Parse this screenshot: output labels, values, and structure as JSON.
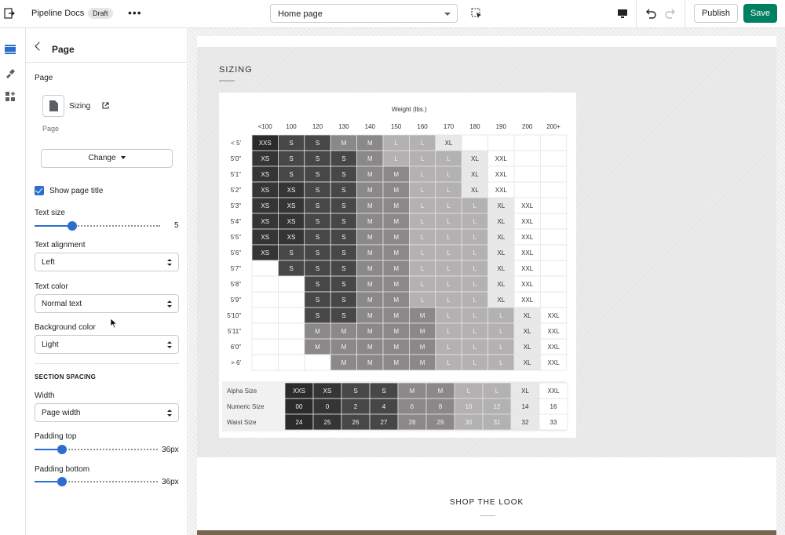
{
  "topbar": {
    "app_name": "Pipeline Docs",
    "status_badge": "Draft",
    "page_select_value": "Home page",
    "publish_label": "Publish",
    "save_label": "Save",
    "icons": [
      "exit-icon",
      "more-icon",
      "inspect-icon",
      "desktop-icon",
      "undo-icon",
      "redo-icon"
    ]
  },
  "rail": {
    "icons": [
      "sections-icon",
      "theme-settings-icon",
      "apps-icon"
    ],
    "accent": "#2c6ecb"
  },
  "panel": {
    "title": "Page",
    "page_label": "Page",
    "page_name": "Sizing",
    "page_type": "Page",
    "change_label": "Change",
    "show_title_label": "Show page title",
    "show_title_checked": true,
    "text_size_label": "Text size",
    "text_size_value": "5",
    "text_size_fraction": 0.3,
    "text_alignment_label": "Text alignment",
    "text_alignment_value": "Left",
    "text_color_label": "Text color",
    "text_color_value": "Normal text",
    "background_color_label": "Background color",
    "background_color_value": "Light",
    "section_spacing_label": "SECTION SPACING",
    "width_label": "Width",
    "width_value": "Page width",
    "padding_top_label": "Padding top",
    "padding_top_value": "36px",
    "padding_top_fraction": 0.22,
    "padding_bottom_label": "Padding bottom",
    "padding_bottom_value": "36px",
    "padding_bottom_fraction": 0.22
  },
  "preview": {
    "sizing_title": "SIZING",
    "shop_title": "SHOP THE LOOK"
  },
  "chart_data": {
    "type": "table",
    "title": "Weight (lbs.)",
    "columns": [
      "<100",
      "100",
      "120",
      "130",
      "140",
      "150",
      "160",
      "170",
      "180",
      "190",
      "200",
      "200+"
    ],
    "rows": [
      {
        "height": "< 5'",
        "cells": [
          "XXS",
          "S",
          "S",
          "M",
          "M",
          "L",
          "L",
          "XL",
          "",
          "",
          "",
          ""
        ]
      },
      {
        "height": "5'0\"",
        "cells": [
          "XS",
          "S",
          "S",
          "S",
          "M",
          "L",
          "L",
          "L",
          "XL",
          "XXL",
          "",
          ""
        ]
      },
      {
        "height": "5'1\"",
        "cells": [
          "XS",
          "S",
          "S",
          "S",
          "M",
          "M",
          "L",
          "L",
          "XL",
          "XXL",
          "",
          ""
        ]
      },
      {
        "height": "5'2\"",
        "cells": [
          "XS",
          "XS",
          "S",
          "S",
          "M",
          "M",
          "L",
          "L",
          "XL",
          "XXL",
          "",
          ""
        ]
      },
      {
        "height": "5'3\"",
        "cells": [
          "XS",
          "XS",
          "S",
          "S",
          "M",
          "M",
          "L",
          "L",
          "L",
          "XL",
          "XXL",
          ""
        ]
      },
      {
        "height": "5'4\"",
        "cells": [
          "XS",
          "XS",
          "S",
          "S",
          "M",
          "M",
          "L",
          "L",
          "L",
          "XL",
          "XXL",
          ""
        ]
      },
      {
        "height": "5'5\"",
        "cells": [
          "XS",
          "XS",
          "S",
          "S",
          "M",
          "M",
          "L",
          "L",
          "L",
          "XL",
          "XXL",
          ""
        ]
      },
      {
        "height": "5'6\"",
        "cells": [
          "XS",
          "S",
          "S",
          "S",
          "M",
          "M",
          "L",
          "L",
          "L",
          "XL",
          "XXL",
          ""
        ]
      },
      {
        "height": "5'7\"",
        "cells": [
          "",
          "S",
          "S",
          "S",
          "M",
          "M",
          "L",
          "L",
          "L",
          "XL",
          "XXL",
          ""
        ]
      },
      {
        "height": "5'8\"",
        "cells": [
          "",
          "",
          "S",
          "S",
          "M",
          "M",
          "L",
          "L",
          "L",
          "XL",
          "XXL",
          ""
        ]
      },
      {
        "height": "5'9\"",
        "cells": [
          "",
          "",
          "S",
          "S",
          "M",
          "M",
          "L",
          "L",
          "L",
          "XL",
          "XXL",
          ""
        ]
      },
      {
        "height": "5'10\"",
        "cells": [
          "",
          "",
          "S",
          "S",
          "M",
          "M",
          "M",
          "L",
          "L",
          "L",
          "XL",
          "XXL"
        ]
      },
      {
        "height": "5'11\"",
        "cells": [
          "",
          "",
          "M",
          "M",
          "M",
          "M",
          "M",
          "L",
          "L",
          "L",
          "XL",
          "XXL"
        ]
      },
      {
        "height": "6'0\"",
        "cells": [
          "",
          "",
          "M",
          "M",
          "M",
          "M",
          "M",
          "L",
          "L",
          "L",
          "XL",
          "XXL"
        ]
      },
      {
        "height": "> 6'",
        "cells": [
          "",
          "",
          "",
          "M",
          "M",
          "M",
          "M",
          "L",
          "L",
          "L",
          "XL",
          "XXL"
        ]
      }
    ],
    "conversion": [
      {
        "label": "Alpha Size",
        "cells": [
          "XXS",
          "XS",
          "S",
          "S",
          "M",
          "M",
          "L",
          "L",
          "XL",
          "XXL"
        ]
      },
      {
        "label": "Numeric Size",
        "cells": [
          "00",
          "0",
          "2",
          "4",
          "6",
          "8",
          "10",
          "12",
          "14",
          "16"
        ]
      },
      {
        "label": "Waist Size",
        "cells": [
          "24",
          "25",
          "26",
          "27",
          "28",
          "29",
          "30",
          "31",
          "32",
          "33"
        ]
      }
    ],
    "size_colors": {
      "XXS": "#2b2b2b",
      "XS": "#353535",
      "S": "#474747",
      "M": "#8a8888",
      "L": "#b3b1b1",
      "XL": "#e8e8e8",
      "XXL": "#ffffff",
      "": "#ffffff"
    }
  }
}
